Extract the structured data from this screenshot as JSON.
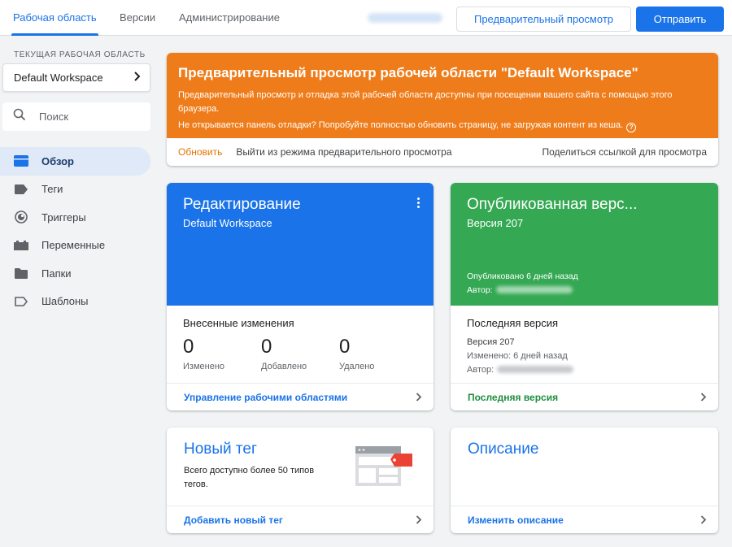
{
  "topbar": {
    "tabs": [
      {
        "label": "Рабочая область",
        "active": true
      },
      {
        "label": "Версии",
        "active": false
      },
      {
        "label": "Администрирование",
        "active": false
      }
    ],
    "preview_button": "Предварительный просмотр",
    "submit_button": "Отправить"
  },
  "sidebar": {
    "workspace_label": "ТЕКУЩАЯ РАБОЧАЯ ОБЛАСТЬ",
    "workspace_name": "Default Workspace",
    "search_placeholder": "Поиск",
    "items": [
      {
        "label": "Обзор",
        "icon": "overview-icon",
        "active": true
      },
      {
        "label": "Теги",
        "icon": "tag-icon",
        "active": false
      },
      {
        "label": "Триггеры",
        "icon": "trigger-icon",
        "active": false
      },
      {
        "label": "Переменные",
        "icon": "variables-icon",
        "active": false
      },
      {
        "label": "Папки",
        "icon": "folder-icon",
        "active": false
      },
      {
        "label": "Шаблоны",
        "icon": "template-icon",
        "active": false
      }
    ]
  },
  "preview_banner": {
    "title": "Предварительный просмотр рабочей области \"Default Workspace\"",
    "text1": "Предварительный просмотр и отладка этой рабочей области доступны при посещении вашего сайта с помощью этого браузера.",
    "text2": "Не открывается панель отладки? Попробуйте полностью обновить страницу, не загружая контент из кеша.",
    "refresh": "Обновить",
    "exit": "Выйти из режима предварительного просмотра",
    "share": "Поделиться ссылкой для просмотра"
  },
  "editing_card": {
    "title": "Редактирование",
    "subtitle": "Default Workspace",
    "changes_title": "Внесенные изменения",
    "counters": [
      {
        "value": "0",
        "label": "Изменено"
      },
      {
        "value": "0",
        "label": "Добавлено"
      },
      {
        "value": "0",
        "label": "Удалено"
      }
    ],
    "footer": "Управление рабочими областями"
  },
  "published_card": {
    "title": "Опубликованная верс...",
    "subtitle": "Версия 207",
    "published": "Опубликовано 6 дней назад",
    "author_label": "Автор:",
    "latest_title": "Последняя версия",
    "latest_version": "Версия 207",
    "latest_changed": "Изменено: 6 дней назад",
    "latest_author": "Автор:",
    "footer": "Последняя версия"
  },
  "newtag_card": {
    "title": "Новый тег",
    "text": "Всего доступно более 50 типов тегов.",
    "footer": "Добавить новый тег"
  },
  "description_card": {
    "title": "Описание",
    "footer": "Изменить описание"
  },
  "colors": {
    "accent": "#1a73e8",
    "banner": "#ef7c1a",
    "green": "#34a853"
  }
}
